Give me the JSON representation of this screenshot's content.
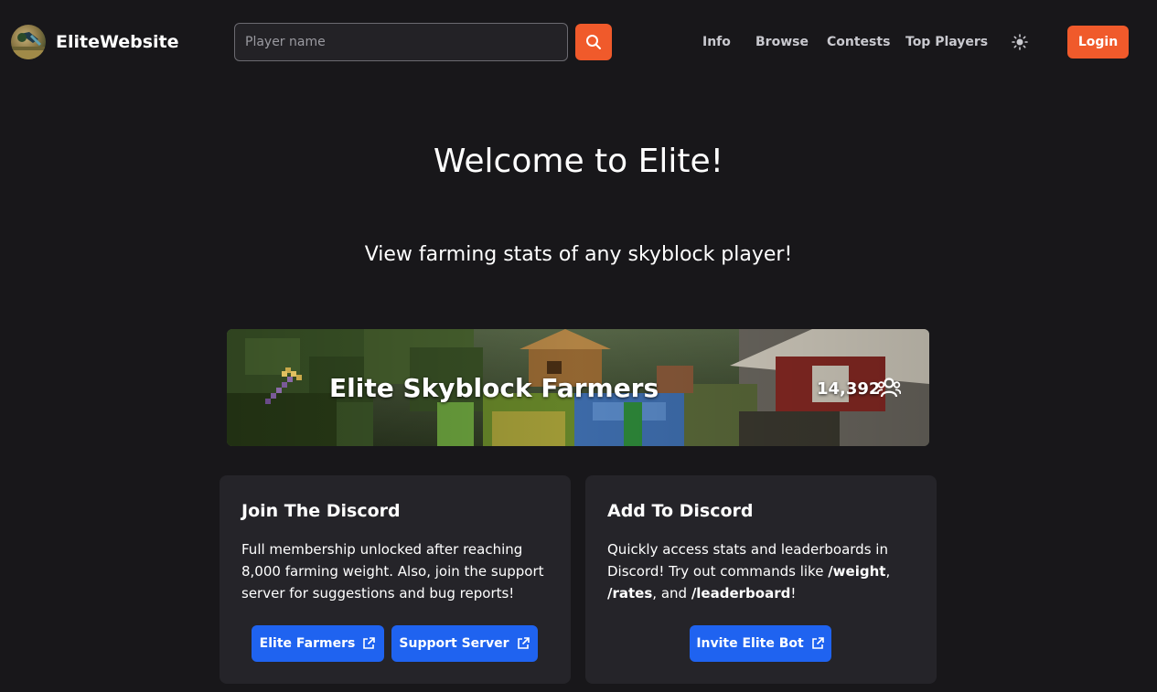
{
  "header": {
    "brand_name": "EliteWebsite",
    "search": {
      "placeholder": "Player name",
      "value": ""
    },
    "nav": [
      "Info",
      "Browse",
      "Contests",
      "Top Players"
    ],
    "login_label": "Login"
  },
  "hero": {
    "title": "Welcome to Elite!",
    "subtitle": "View farming stats of any skyblock player!"
  },
  "banner": {
    "title": "Elite Skyblock Farmers",
    "member_count": "14,392"
  },
  "cards": {
    "join": {
      "title": "Join The Discord",
      "text": "Full membership unlocked after reaching 8,000 farming weight. Also, join the support server for suggestions and bug reports!",
      "buttons": [
        "Elite Farmers",
        "Support Server"
      ]
    },
    "add": {
      "title": "Add To Discord",
      "text_parts": [
        "Quickly access stats and leaderboards in Discord! Try out commands like ",
        "/weight",
        ", ",
        "/rates",
        ", and ",
        "/leaderboard",
        "!"
      ],
      "button": "Invite Elite Bot"
    }
  },
  "colors": {
    "background": "#18171a",
    "accent": "#f05a2b",
    "primary_button": "#1f63f0",
    "card": "#252429"
  },
  "icons": {
    "search": "search-icon",
    "theme": "sun-icon",
    "members": "users-icon",
    "external": "external-link-icon",
    "pickaxe": "pickaxe-icon"
  }
}
